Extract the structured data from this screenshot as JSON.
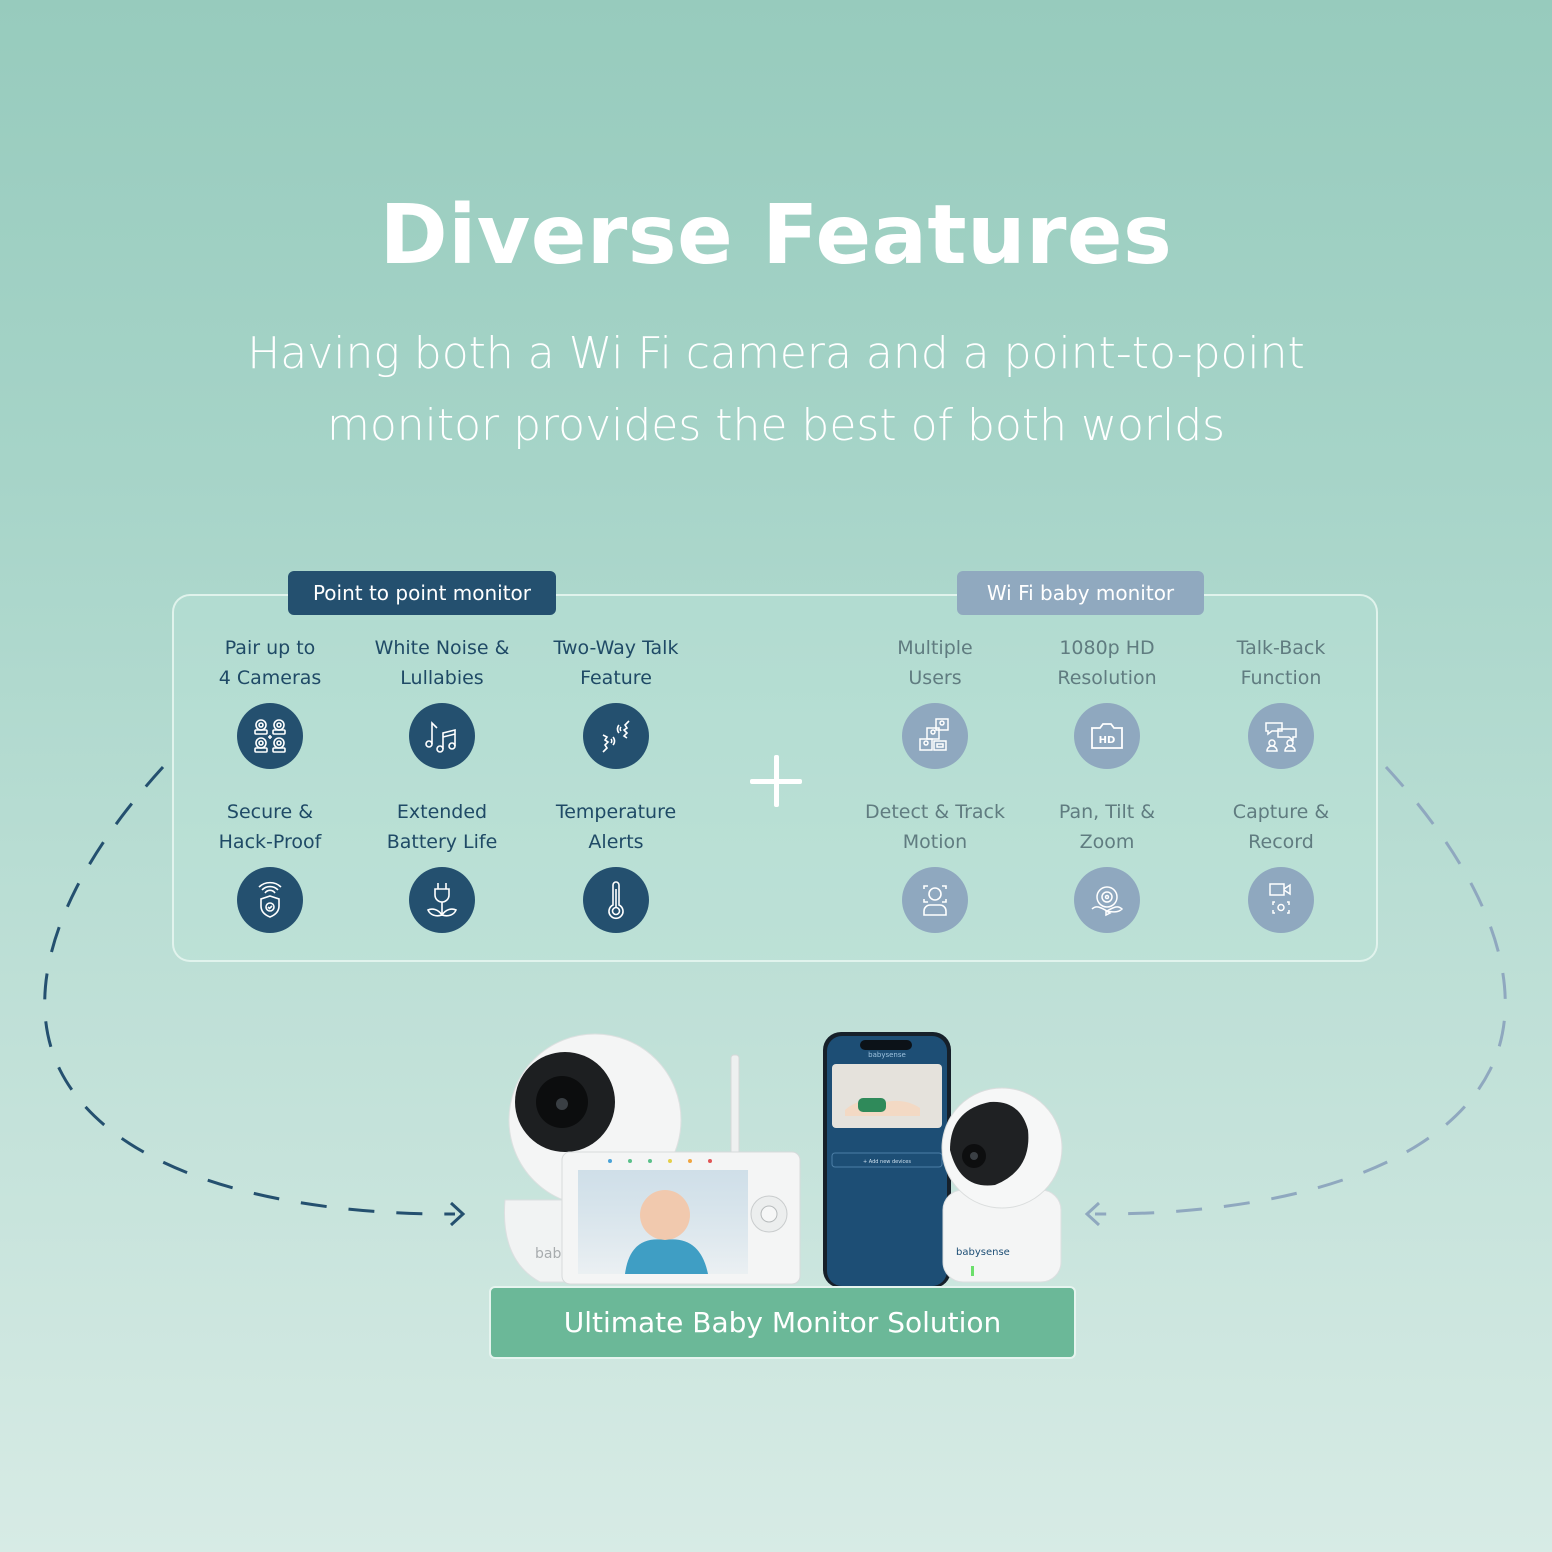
{
  "header": {
    "title": "Diverse Features",
    "subtitle": "Having both a Wi Fi camera and a point-to-point monitor provides the best of both worlds"
  },
  "groups": {
    "point_to_point": {
      "tag": "Point to point monitor",
      "color": "#24506f",
      "features": [
        {
          "label": "Pair up to\n4 Cameras",
          "icon": "four-cameras-icon"
        },
        {
          "label": "White Noise &\nLullabies",
          "icon": "music-notes-icon"
        },
        {
          "label": "Two-Way Talk\nFeature",
          "icon": "two-way-talk-icon"
        },
        {
          "label": "Secure &\nHack-Proof",
          "icon": "wifi-shield-icon"
        },
        {
          "label": "Extended\nBattery Life",
          "icon": "eco-plug-icon"
        },
        {
          "label": "Temperature\nAlerts",
          "icon": "thermometer-icon"
        }
      ]
    },
    "wifi": {
      "tag": "Wi Fi baby monitor",
      "color": "#8fa8bf",
      "features": [
        {
          "label": "Multiple\nUsers",
          "icon": "multiple-users-icon"
        },
        {
          "label": "1080p HD\nResolution",
          "icon": "hd-camera-icon"
        },
        {
          "label": "Talk-Back\nFunction",
          "icon": "talk-back-icon"
        },
        {
          "label": "Detect & Track\nMotion",
          "icon": "face-detect-icon"
        },
        {
          "label": "Pan, Tilt &\nZoom",
          "icon": "pan-tilt-zoom-icon"
        },
        {
          "label": "Capture &\nRecord",
          "icon": "capture-record-icon"
        }
      ]
    }
  },
  "products": {
    "brand": "babysense",
    "phone_add_label": "+ Add new devices"
  },
  "solution_label": "Ultimate Baby Monitor Solution",
  "colors": {
    "accent_green": "#6bb898",
    "dark_navy": "#24506f",
    "muted_blue": "#8fa8bf"
  }
}
